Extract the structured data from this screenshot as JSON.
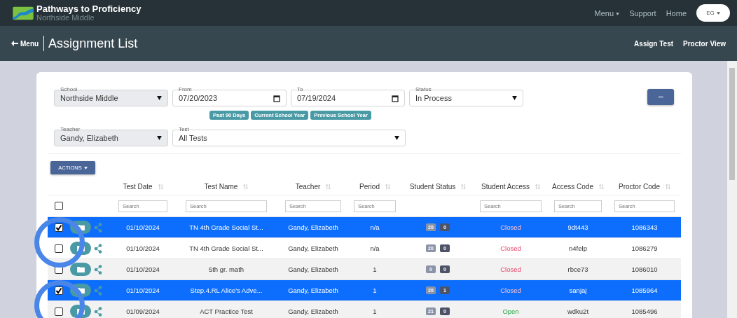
{
  "app": {
    "title": "Pathways to Proficiency",
    "subtitle": "Northside Middle"
  },
  "nav": [
    {
      "label": "Menu",
      "dropdown": true
    },
    {
      "label": "Support",
      "dropdown": false
    },
    {
      "label": "Home",
      "dropdown": false
    }
  ],
  "user": {
    "initials": "EG"
  },
  "header": {
    "back": "Menu",
    "title": "Assignment List",
    "links": [
      "Assign Test",
      "Proctor View"
    ]
  },
  "filters": {
    "school": {
      "label": "School",
      "value": "Northside Middle"
    },
    "from": {
      "label": "From",
      "value": "07/20/2023"
    },
    "to": {
      "label": "To",
      "value": "07/19/2024"
    },
    "status": {
      "label": "Status",
      "value": "In Process"
    },
    "teacher": {
      "label": "Teacher",
      "value": "Gandy, Elizabeth"
    },
    "test": {
      "label": "Test",
      "value": "All Tests"
    }
  },
  "collapse_button": "−",
  "ranges": [
    "Past 90 Days",
    "Current School Year",
    "Previous School Year"
  ],
  "actions_button": "ACTIONS",
  "table": {
    "select_all": {
      "checked": false
    },
    "columns": [
      {
        "label": "Test Date",
        "placeholder": "Search"
      },
      {
        "label": "Test Name",
        "placeholder": "Search"
      },
      {
        "label": "Teacher",
        "placeholder": "Search"
      },
      {
        "label": "Period",
        "placeholder": "Search"
      },
      {
        "label": "Student Status"
      },
      {
        "label": "Student Access",
        "placeholder": "Search"
      },
      {
        "label": "Access Code",
        "placeholder": "Search"
      },
      {
        "label": "Proctor Code",
        "placeholder": "Search"
      }
    ],
    "rows": [
      {
        "selected": true,
        "date": "01/10/2024",
        "name": "TN 4th Grade Social St...",
        "teacher": "Gandy, Elizabeth",
        "period": "n/a",
        "count_a": "20",
        "count_b": "0",
        "access": "Closed",
        "access_open": false,
        "access_code": "9dt443",
        "proctor_code": "1086343"
      },
      {
        "selected": false,
        "date": "01/10/2024",
        "name": "TN 4th Grade Social St...",
        "teacher": "Gandy, Elizabeth",
        "period": "n/a",
        "count_a": "20",
        "count_b": "0",
        "access": "Closed",
        "access_open": false,
        "access_code": "n4felp",
        "proctor_code": "1086279"
      },
      {
        "selected": false,
        "date": "01/10/2024",
        "name": "5th gr. math",
        "teacher": "Gandy, Elizabeth",
        "period": "1",
        "count_a": "0",
        "count_b": "0",
        "access": "Closed",
        "access_open": false,
        "access_code": "rbce73",
        "proctor_code": "1086010"
      },
      {
        "selected": true,
        "date": "01/10/2024",
        "name": "Step.4.RL Alice's Adve...",
        "teacher": "Gandy, Elizabeth",
        "period": "1",
        "count_a": "20",
        "count_b": "1",
        "access": "Closed",
        "access_open": false,
        "access_code": "sanjaj",
        "proctor_code": "1085964"
      },
      {
        "selected": false,
        "date": "01/09/2024",
        "name": "ACT Practice Test",
        "teacher": "Gandy, Elizabeth",
        "period": "1",
        "count_a": "21",
        "count_b": "0",
        "access": "Open",
        "access_open": true,
        "access_code": "wdku2t",
        "proctor_code": "1085496"
      }
    ]
  }
}
